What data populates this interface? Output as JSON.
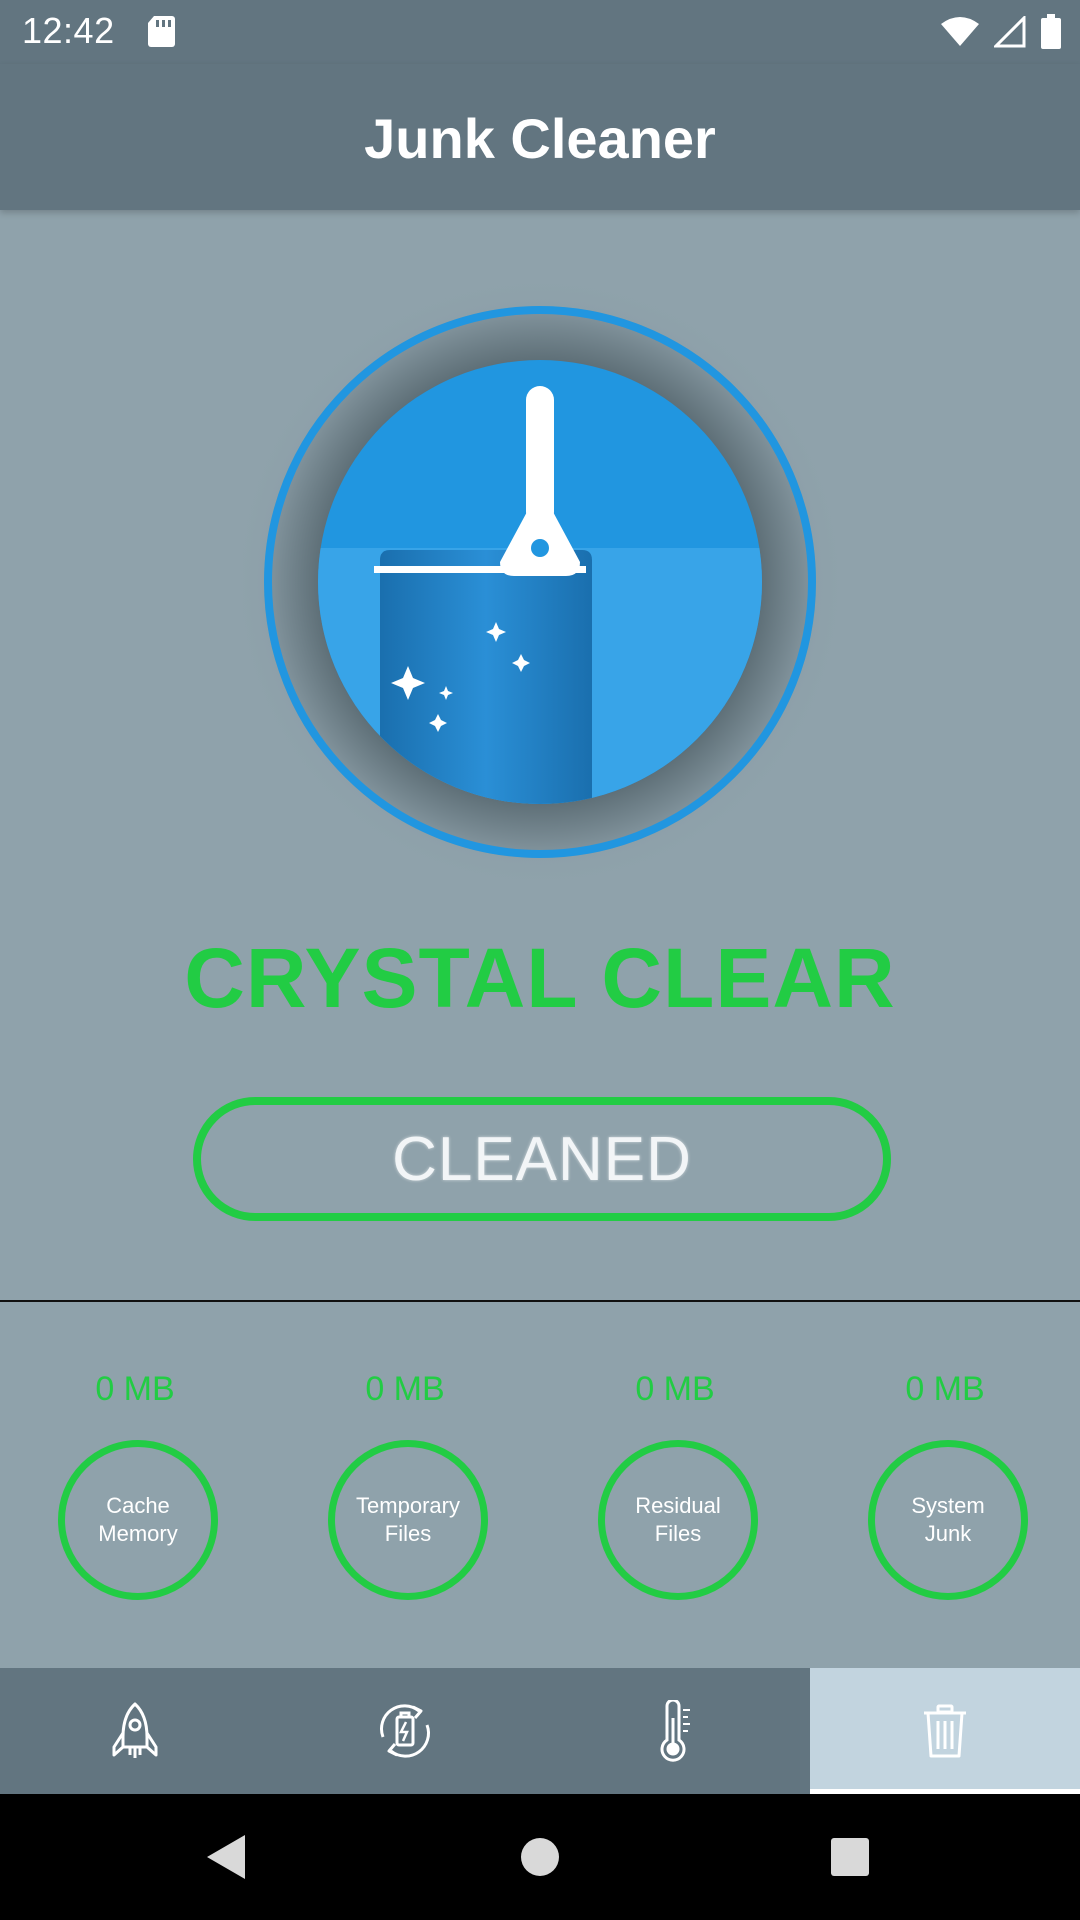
{
  "status_bar": {
    "time": "12:42",
    "icons": [
      "sd-card-icon",
      "wifi-icon",
      "cell-signal-icon",
      "battery-icon"
    ]
  },
  "app_bar": {
    "title": "Junk Cleaner"
  },
  "hero": {
    "icon": "broom-brush-icon",
    "accent_color": "#2196e0"
  },
  "status_headline": "CRYSTAL CLEAR",
  "action_button": {
    "label": "CLEANED"
  },
  "categories": [
    {
      "size": "0 MB",
      "label": "Cache Memory"
    },
    {
      "size": "0 MB",
      "label": "Temporary Files"
    },
    {
      "size": "0 MB",
      "label": "Residual Files"
    },
    {
      "size": "0 MB",
      "label": "System Junk"
    }
  ],
  "bottom_nav": {
    "items": [
      {
        "icon": "rocket-icon",
        "active": false
      },
      {
        "icon": "battery-refresh-icon",
        "active": false
      },
      {
        "icon": "thermometer-icon",
        "active": false
      },
      {
        "icon": "trash-icon",
        "active": true
      }
    ]
  },
  "system_nav": {
    "icons": [
      "back-icon",
      "home-icon",
      "recents-icon"
    ]
  },
  "colors": {
    "app_bar": "#627580",
    "background": "#8fa2ab",
    "success_green": "#22cc44",
    "active_tab": "#c2d4df"
  }
}
